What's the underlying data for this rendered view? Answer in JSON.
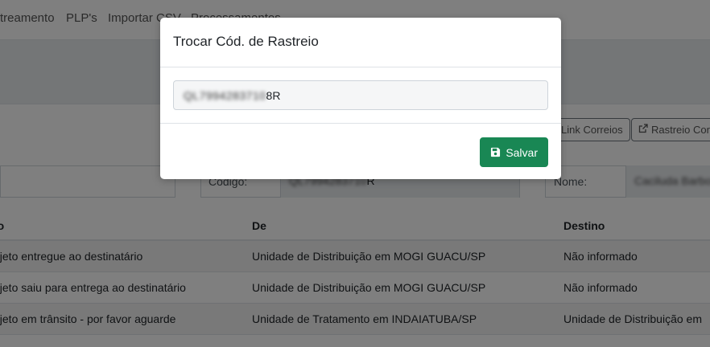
{
  "nav": {
    "items": [
      "treamento",
      "PLP's",
      "Importar CSV",
      "Processamentos"
    ]
  },
  "actions": {
    "link_correios": "Link Correios",
    "rastreio_correios": "Rastreio Cor"
  },
  "info": {
    "codigo_label": "Código:",
    "codigo_value_masked": "QL7994283710",
    "codigo_value_suffix": "R",
    "nome_label": "Nome:",
    "nome_value_masked": "Caciluda Barbosa"
  },
  "table": {
    "headers": [
      "fo",
      "De",
      "Destino"
    ],
    "rows": [
      [
        "bjeto entregue ao destinatário",
        "Unidade de Distribuição em MOGI GUACU/SP",
        "Não informado"
      ],
      [
        "bjeto saiu para entrega ao destinatário",
        "Unidade de Distribuição em MOGI GUACU/SP",
        "Não informado"
      ],
      [
        "bjeto em trânsito - por favor aguarde",
        "Unidade de Tratamento em INDAIATUBA/SP",
        "Unidade de Distribuição em"
      ]
    ]
  },
  "modal": {
    "title": "Trocar Cód. de Rastreio",
    "input_masked": "QL7994283710",
    "input_suffix": "8R",
    "save_label": "Salvar",
    "save_icon": "save-icon",
    "accent_color": "#198754"
  }
}
